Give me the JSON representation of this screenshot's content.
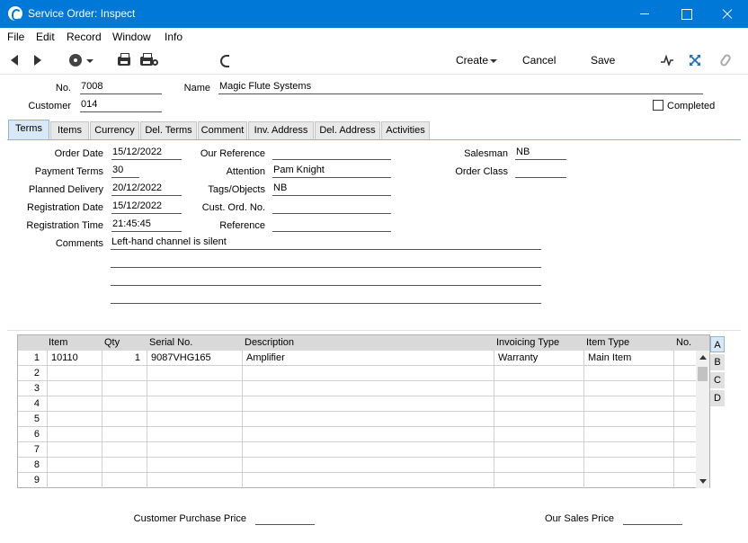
{
  "window": {
    "title": "Service Order: Inspect"
  },
  "menu": [
    "File",
    "Edit",
    "Record",
    "Window",
    "Info"
  ],
  "toolbar": {
    "create": "Create",
    "cancel": "Cancel",
    "save": "Save"
  },
  "header": {
    "no_label": "No.",
    "no_value": "7008",
    "name_label": "Name",
    "name_value": "Magic Flute Systems",
    "customer_label": "Customer",
    "customer_value": "014",
    "completed_label": "Completed"
  },
  "tabs": [
    "Terms",
    "Items",
    "Currency",
    "Del. Terms",
    "Comment",
    "Inv. Address",
    "Del. Address",
    "Activities"
  ],
  "terms": {
    "order_date_label": "Order Date",
    "order_date": "15/12/2022",
    "payment_terms_label": "Payment Terms",
    "payment_terms": "30",
    "planned_delivery_label": "Planned Delivery",
    "planned_delivery": "20/12/2022",
    "registration_date_label": "Registration Date",
    "registration_date": "15/12/2022",
    "registration_time_label": "Registration Time",
    "registration_time": "21:45:45",
    "comments_label": "Comments",
    "comments": "Left-hand channel is silent",
    "our_reference_label": "Our Reference",
    "our_reference": "",
    "attention_label": "Attention",
    "attention": "Pam Knight",
    "tags_label": "Tags/Objects",
    "tags": "NB",
    "cust_ord_label": "Cust. Ord. No.",
    "cust_ord": "",
    "reference_label": "Reference",
    "reference": "",
    "salesman_label": "Salesman",
    "salesman": "NB",
    "order_class_label": "Order Class",
    "order_class": ""
  },
  "grid": {
    "columns": [
      "Item",
      "Qty",
      "Serial No.",
      "Description",
      "Invoicing Type",
      "Item Type",
      "No."
    ],
    "rows": [
      {
        "n": "1",
        "item": "10110",
        "qty": "1",
        "serial": "9087VHG165",
        "desc": "Amplifier",
        "inv_type": "Warranty",
        "item_type": "Main Item",
        "no": ""
      },
      {
        "n": "2"
      },
      {
        "n": "3"
      },
      {
        "n": "4"
      },
      {
        "n": "5"
      },
      {
        "n": "6"
      },
      {
        "n": "7"
      },
      {
        "n": "8"
      },
      {
        "n": "9"
      }
    ],
    "side_tabs": [
      "A",
      "B",
      "C",
      "D"
    ]
  },
  "footer": {
    "customer_purchase_price_label": "Customer Purchase Price",
    "our_sales_price_label": "Our Sales Price"
  }
}
